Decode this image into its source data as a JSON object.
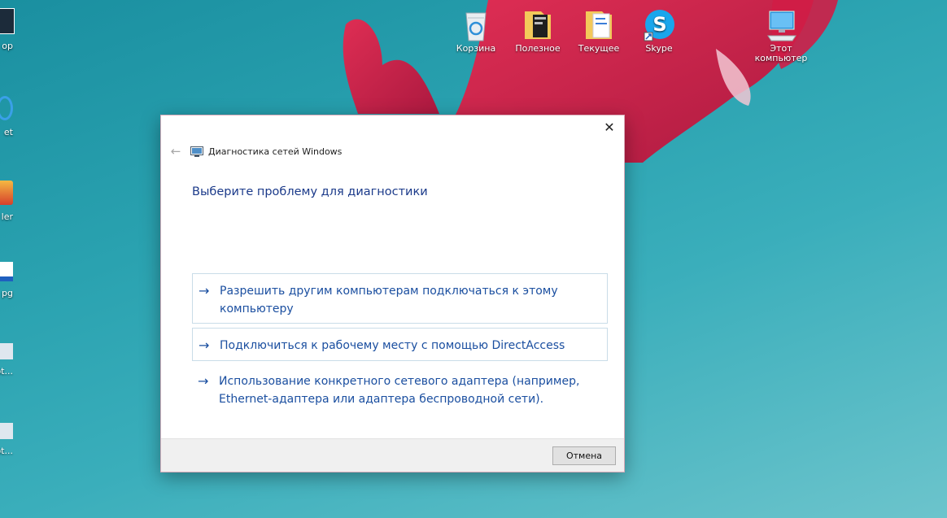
{
  "desktop": {
    "icons": [
      {
        "label": "Корзина"
      },
      {
        "label": "Полезное"
      },
      {
        "label": "Текущее"
      },
      {
        "label": "Skype"
      },
      {
        "label": "Этот компьютер"
      }
    ],
    "edge_labels": [
      "ор",
      "et",
      "ler",
      "pg",
      "ot...",
      "ot..."
    ]
  },
  "dialog": {
    "title": "Диагностика сетей Windows",
    "back_symbol": "←",
    "close_symbol": "✕",
    "heading": "Выберите проблему для диагностики",
    "options": [
      {
        "label": "Разрешить другим компьютерам подключаться к этому компьютеру"
      },
      {
        "label": "Подключиться к рабочему месту с помощью DirectAccess"
      },
      {
        "label": "Использование конкретного сетевого адаптера (например, Ethernet-адаптера или адаптера беспроводной сети)."
      }
    ],
    "arrow_symbol": "→",
    "cancel_label": "Отмена"
  },
  "colors": {
    "link_blue": "#1b4fa0",
    "heading_blue": "#1b3a8a",
    "wallpaper_teal": "#2aa2b0",
    "flower_red": "#d8204a"
  }
}
